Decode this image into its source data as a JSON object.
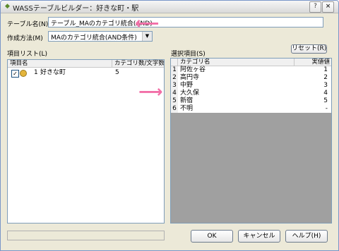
{
  "window": {
    "title": "WASSテーブルビルダー：好きな町・駅"
  },
  "titlebar": {
    "help_label": "?",
    "close_label": "×"
  },
  "form": {
    "table_name_label": "テーブル名(N)",
    "table_name_value": "テーブル_MAのカテゴリ統合(AND)",
    "method_label": "作成方法(M)",
    "method_value": "MAのカテゴリ統合(AND条件)"
  },
  "item_list": {
    "label": "項目リスト(L)",
    "headers": [
      "項目名",
      "カテゴリ数/文字数"
    ],
    "rows": [
      {
        "checked": true,
        "number": "1",
        "name": "好きな町",
        "count": "5"
      }
    ]
  },
  "selected_items": {
    "label": "選択項目(S)",
    "reset_label": "リセット(R)",
    "headers": [
      "カテゴリ名",
      "実値値"
    ],
    "rows": [
      {
        "no": "1",
        "name": "阿佐ヶ谷",
        "value": "1"
      },
      {
        "no": "2",
        "name": "高円寺",
        "value": "2"
      },
      {
        "no": "3",
        "name": "中野",
        "value": "3"
      },
      {
        "no": "4",
        "name": "大久保",
        "value": "4"
      },
      {
        "no": "5",
        "name": "新宿",
        "value": "5"
      },
      {
        "no": "6",
        "name": "不明",
        "value": "-"
      }
    ]
  },
  "buttons": {
    "ok": "OK",
    "cancel": "キャンセル",
    "help": "ヘルプ(H)"
  },
  "colors": {
    "annotation_arrow": "#f26fa7",
    "grid_background": "#a0a0a0"
  },
  "icons": {
    "annotation": "pink-arrow-icon",
    "item": "gold-category-icon"
  }
}
